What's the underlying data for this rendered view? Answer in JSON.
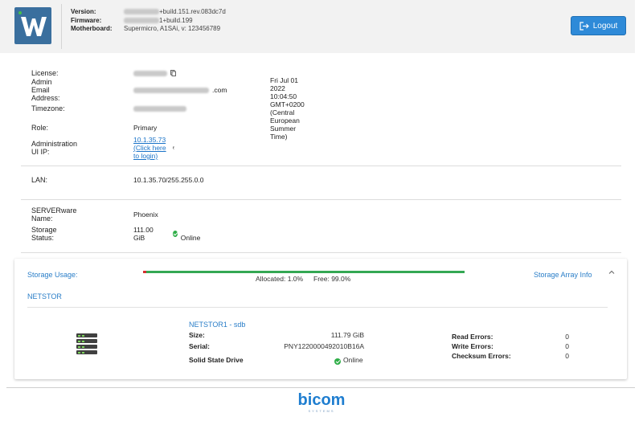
{
  "header": {
    "version_label": "Version:",
    "version_suffix": "+build.151.rev.083dc7d",
    "firmware_label": "Firmware:",
    "firmware_suffix": "1+build.199",
    "motherboard_label": "Motherboard:",
    "motherboard_value": "Supermicro, A1SAi, v: 123456789",
    "logout_label": "Logout"
  },
  "details": {
    "license_label": "License:",
    "admin_email_label": "Admin Email Address:",
    "admin_email_suffix": ".com",
    "timezone_label": "Timezone:",
    "datetime": "Fri Jul 01 2022 10:04:50 GMT+0200 (Central European Summer Time)",
    "role_label": "Role:",
    "role_value": "Primary",
    "admin_ip_label": "Administration UI IP:",
    "admin_ip_link": "10.1.35.73 (Click here to login)",
    "lan_label": "LAN:",
    "lan_value": "10.1.35.70/255.255.0.0",
    "server_name_label": "SERVERware Name:",
    "server_name_value": "Phoenix",
    "storage_status_label": "Storage Status:",
    "storage_status_size": "111.00 GiB",
    "storage_status_state": "Online"
  },
  "storage": {
    "usage_label": "Storage Usage:",
    "allocated_text": "Allocated: 1.0%",
    "free_text": "Free: 99.0%",
    "allocated_fraction": 0.01,
    "array_info_label": "Storage Array Info",
    "netstor_label": "NETSTOR",
    "disk": {
      "title": "NETSTOR1 - sdb",
      "size_label": "Size:",
      "size_value": "111.79 GiB",
      "serial_label": "Serial:",
      "serial_value": "PNY1220000492010B16A",
      "type_label": "Solid State Drive",
      "status": "Online",
      "read_errors_label": "Read Errors:",
      "read_errors_value": "0",
      "write_errors_label": "Write Errors:",
      "write_errors_value": "0",
      "checksum_errors_label": "Checksum Errors:",
      "checksum_errors_value": "0"
    }
  },
  "footer": {
    "brand": "bicom",
    "brand_sub": "SYSTEMS"
  },
  "colors": {
    "accent": "#2e8ad8",
    "link": "#2a7ec8",
    "ok": "#2fae48",
    "bar_free": "#34a853",
    "bar_used": "#d32f2f",
    "logo": "#3a6f9e"
  },
  "icons": {
    "logo": "serverware-w-logo",
    "logout": "logout-icon",
    "copy": "copy-icon",
    "ok": "check-circle-icon",
    "chevron": "chevron-up-icon",
    "disk": "disk-stack-icon"
  }
}
